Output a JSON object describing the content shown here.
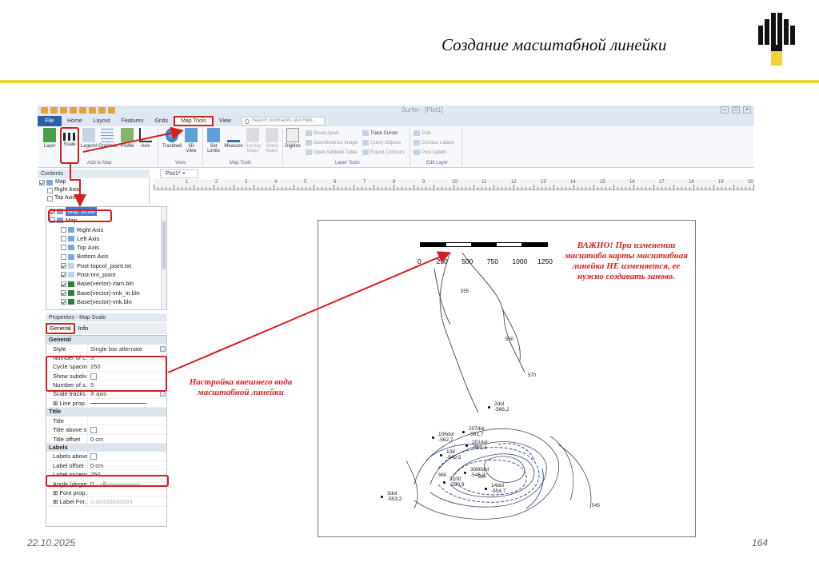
{
  "slide": {
    "title": "Создание масштабной линейки",
    "date": "22.10.2025",
    "page_number": "164",
    "accent_color": "#f2d23a",
    "logo_icon": "rosneft-logo"
  },
  "app": {
    "window_title": "Surfer - [Plot1]",
    "tabs": [
      "File",
      "Home",
      "Layout",
      "Features",
      "Grids",
      "Map Tools",
      "View"
    ],
    "selected_tab": "Map Tools",
    "search_placeholder": "Search commands and Help...",
    "ribbon": {
      "buttons": [
        "Layer",
        "Scale",
        "Legend",
        "Graticule",
        "Profile",
        "Axis",
        "Trackball",
        "3D View",
        "Set Limits",
        "Measure",
        "Overlay Maps",
        "Stack Maps",
        "Digitize"
      ],
      "small_buttons": [
        "Break Apart",
        "Georeference Image",
        "Open Attribute Table",
        "Track Cursor",
        "Query Objects",
        "Export Contours",
        "Grid",
        "Contour Labels",
        "Post Labels"
      ],
      "groups": [
        "Add to Map",
        "View",
        "Map Tools",
        "Layer Tools",
        "Edit Layer"
      ]
    },
    "contents": {
      "header": "Contents",
      "top_items": [
        "Map",
        "Right Axis",
        "Top Axis"
      ]
    },
    "doc_tab": "Plot1*",
    "ruler_numbers": [
      "1",
      "2",
      "3",
      "4",
      "5",
      "6",
      "7",
      "8",
      "9",
      "10",
      "11",
      "12",
      "13",
      "14",
      "15",
      "16",
      "17",
      "18",
      "19",
      "20"
    ],
    "tree": [
      {
        "label": "Map Scale",
        "indent": 0,
        "selected": true
      },
      {
        "label": "Map",
        "indent": 0
      },
      {
        "label": "Right Axis",
        "indent": 1
      },
      {
        "label": "Left Axis",
        "indent": 1
      },
      {
        "label": "Top Axis",
        "indent": 1
      },
      {
        "label": "Bottom Axis",
        "indent": 1
      },
      {
        "label": "Post-topcol_point.txt",
        "indent": 1
      },
      {
        "label": "Post-nnt_point",
        "indent": 1
      },
      {
        "label": "Base(vector)-zam.bln",
        "indent": 1
      },
      {
        "label": "Base(vector)-vnk_in.bln",
        "indent": 1
      },
      {
        "label": "Base(vector)-vnk.bln",
        "indent": 1
      }
    ],
    "properties": {
      "header": "Properties - Map Scale",
      "tabs": [
        "General",
        "Info"
      ],
      "rows": [
        {
          "type": "section",
          "label": "General"
        },
        {
          "label": "Style",
          "value": "Single bar alternate",
          "dd": true
        },
        {
          "label": "Number of c...",
          "value": "5"
        },
        {
          "label": "Cycle spacing",
          "value": "250"
        },
        {
          "label": "Show subdivi...",
          "value": "",
          "check": true
        },
        {
          "label": "Number of s...",
          "value": "5"
        },
        {
          "label": "Scale tracks",
          "value": "X axis",
          "dd": true
        },
        {
          "label": "⊞ Line prop...",
          "value": "",
          "line": true
        },
        {
          "type": "section",
          "label": "Title"
        },
        {
          "label": "Title",
          "value": ""
        },
        {
          "label": "Title above s...",
          "value": "",
          "check": true
        },
        {
          "label": "Title offset",
          "value": "0 cm"
        },
        {
          "type": "section",
          "label": "Labels"
        },
        {
          "label": "Labels above...",
          "value": "",
          "check": true
        },
        {
          "label": "Label offset",
          "value": "0 cm"
        },
        {
          "label": "Label increm...",
          "value": "250"
        },
        {
          "label": "Angle (degre...",
          "value": "0",
          "slider": true
        },
        {
          "label": "⊞ Font prop...",
          "value": ""
        },
        {
          "label": "⊞ Label For...",
          "value": "d,ddddddddddd",
          "dim": true
        }
      ]
    }
  },
  "map": {
    "scale_labels": [
      "0",
      "250",
      "500",
      "750",
      "1000",
      "1250"
    ],
    "contour_labels": [
      "555",
      "550",
      "570",
      "545",
      "560",
      "565"
    ],
    "wells": [
      {
        "name": "2dol",
        "value": "-566,2"
      },
      {
        "name": "207dol",
        "value": "-561,7"
      },
      {
        "name": "106dol",
        "value": "-562,7"
      },
      {
        "name": "201dol",
        "value": "-560,4"
      },
      {
        "name": "108",
        "value": "-549,5"
      },
      {
        "name": "3080dol",
        "value": "-545,2"
      },
      {
        "name": "3100",
        "value": "-550,9"
      },
      {
        "name": "14dol",
        "value": "-554,7"
      },
      {
        "name": "3dol",
        "value": "-553,2"
      }
    ]
  },
  "annotations": {
    "important": "ВАЖНО! При изменении масштаба карты масштабная линейка НЕ изменяется, ее нужно создавать заново.",
    "setup": "Настройка внешнего вида масштабной линейки"
  }
}
